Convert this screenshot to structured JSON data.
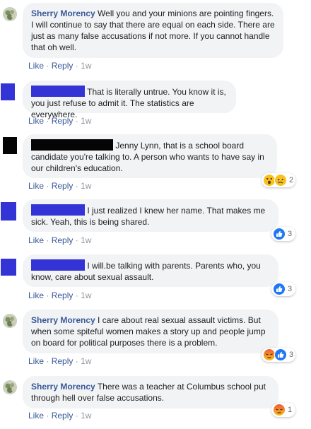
{
  "actions": {
    "like": "Like",
    "reply": "Reply",
    "separator": "·",
    "time": "1w"
  },
  "comments": [
    {
      "author": "Sherry Morency",
      "text": "Well you and your minions are pointing fingers. I will continue to say that there are equal on each side. There are just as many false accusations if not more. If you cannot handle that oh well."
    },
    {
      "author": "",
      "text": "That is literally untrue. You know it is, you just refuse to admit it. The statistics are everywhere."
    },
    {
      "author": "",
      "text": "Jenny Lynn, that is a school board candidate you're talking to. A person who wants to have say in our children's education.",
      "reactions": [
        "wow",
        "sad"
      ],
      "reaction_count": "2"
    },
    {
      "author": "",
      "text": "I just realized I knew her name. That makes me sick. Yeah, this is being shared.",
      "reactions": [
        "like"
      ],
      "reaction_count": "3"
    },
    {
      "author": "",
      "text": "I will.be talking with parents. Parents who, you know, care about sexual assault.",
      "reactions": [
        "like"
      ],
      "reaction_count": "3"
    },
    {
      "author": "Sherry Morency",
      "text": "I care about real sexual assault victims. But when some spiteful women makes a story up and people jump on board for political purposes there is a problem.",
      "reactions": [
        "angry",
        "like"
      ],
      "reaction_count": "3"
    },
    {
      "author": "Sherry Morency",
      "text": "There was a teacher at Columbus school put through hell over false accusations.",
      "reactions": [
        "angry"
      ],
      "reaction_count": "1"
    }
  ],
  "colors": {
    "link": "#385898",
    "bubble": "#f2f3f5",
    "meta": "#90949c",
    "redaction_blue": "#3333d6",
    "redaction_black": "#050505",
    "like_blue": "#2078f4",
    "angry_orange": "#f26a3d",
    "wow_yellow": "#f7c21f"
  }
}
